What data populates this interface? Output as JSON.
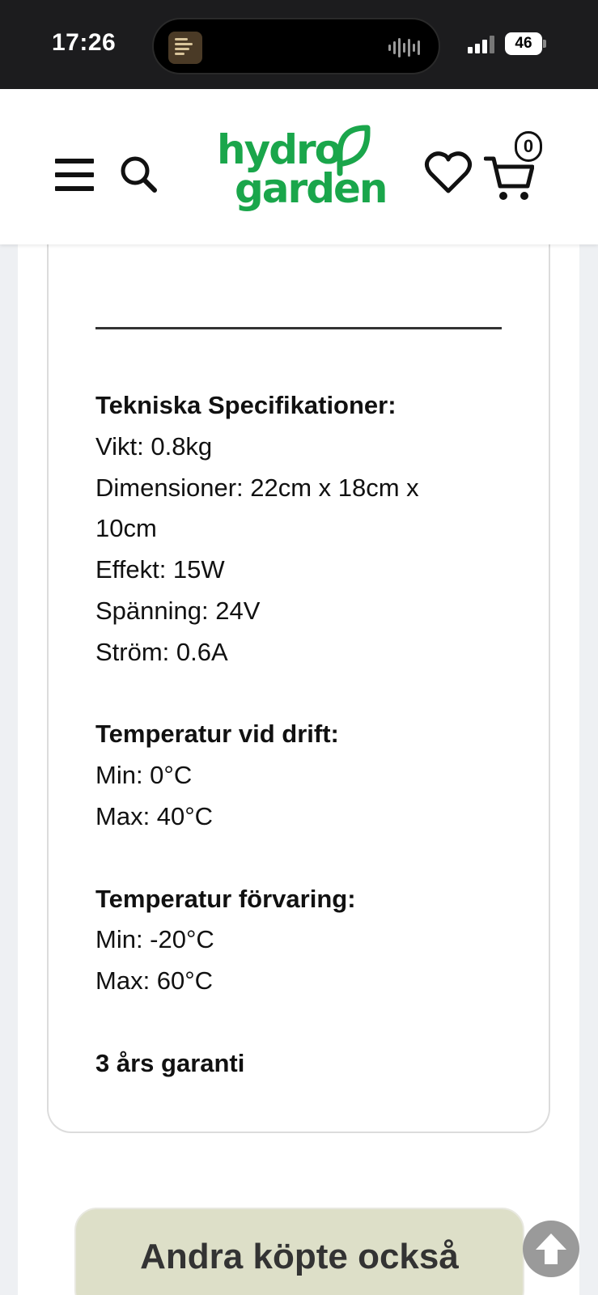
{
  "status_bar": {
    "time": "17:26",
    "battery": "46"
  },
  "header": {
    "logo_line1": "hydro",
    "logo_line2": "garden",
    "cart_count": "0",
    "brand_color": "#1aa64b"
  },
  "specs": {
    "lines": [
      {
        "text": "Tekniska Specifikationer:",
        "bold": true
      },
      {
        "text": "Vikt: 0.8kg",
        "bold": false
      },
      {
        "text": "Dimensioner: 22cm x 18cm x",
        "bold": false
      },
      {
        "text": "10cm",
        "bold": false
      },
      {
        "text": "Effekt: 15W",
        "bold": false
      },
      {
        "text": "Spänning: 24V",
        "bold": false
      },
      {
        "text": "Ström: 0.6A",
        "bold": false
      },
      {
        "text": "",
        "bold": false
      },
      {
        "text": "Temperatur vid drift:",
        "bold": true
      },
      {
        "text": "Min: 0°C",
        "bold": false
      },
      {
        "text": "Max: 40°C",
        "bold": false
      },
      {
        "text": "",
        "bold": false
      },
      {
        "text": "Temperatur förvaring:",
        "bold": true
      },
      {
        "text": "Min: -20°C",
        "bold": false
      },
      {
        "text": "Max: 60°C",
        "bold": false
      },
      {
        "text": "",
        "bold": false
      },
      {
        "text": "3 års garanti",
        "bold": true
      }
    ]
  },
  "related": {
    "title": "Andra köpte också"
  },
  "icons": {
    "menu": "hamburger-menu-icon",
    "search": "search-icon",
    "wishlist": "heart-icon",
    "cart": "cart-icon",
    "scroll_top": "arrow-up-icon"
  }
}
